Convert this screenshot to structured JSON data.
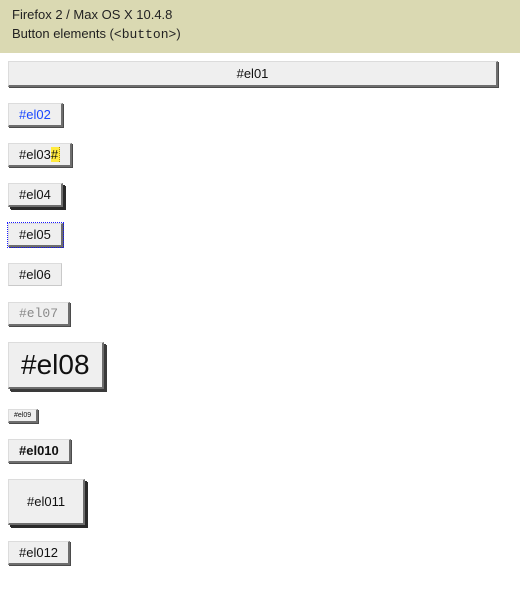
{
  "header": {
    "env": "Firefox 2 / Max OS X 10.4.8",
    "title_prefix": "Button elements (",
    "title_code": "<button>",
    "title_suffix": ")"
  },
  "buttons": {
    "el01": "#el01",
    "el02": "#el02",
    "el03_main": "#el03",
    "el03_tail": "#",
    "el04": "#el04",
    "el05": "#el05",
    "el06": "#el06",
    "el07": "#el07",
    "el08": "#el08",
    "el09": "#el09",
    "el010": "#el010",
    "el011": "#el011",
    "el012": "#el012"
  }
}
